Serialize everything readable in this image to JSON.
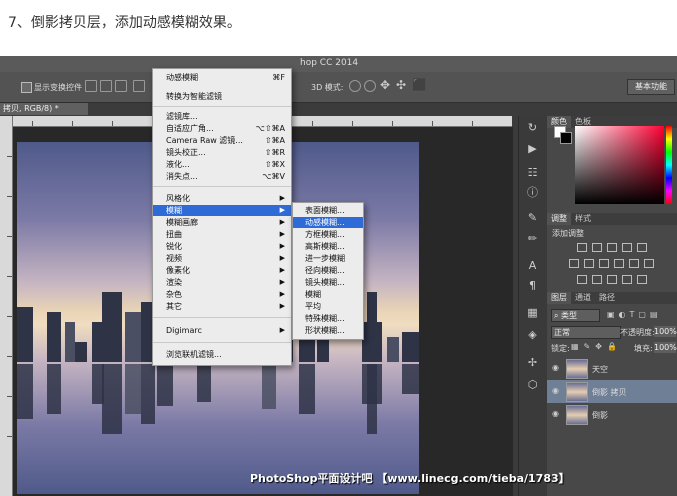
{
  "step_text": "7、倒影拷贝层，添加动感模糊效果。",
  "app_title_partial": "hop CC 2014",
  "workspace": "基本功能",
  "toolbar": {
    "show_transform": "显示变换控件",
    "mode3d": "3D 模式:"
  },
  "doc_tab": "拷贝, RGB/8) *",
  "filter_menu": {
    "items": [
      {
        "label": "动感模糊",
        "shortcut": "⌘F"
      },
      {
        "label": "转换为智能滤镜",
        "shortcut": ""
      },
      {
        "label": "滤镜库...",
        "shortcut": ""
      },
      {
        "label": "自适应广角...",
        "shortcut": "⌥⇧⌘A"
      },
      {
        "label": "Camera Raw 滤镜...",
        "shortcut": "⇧⌘A"
      },
      {
        "label": "镜头校正...",
        "shortcut": "⇧⌘R"
      },
      {
        "label": "液化...",
        "shortcut": "⇧⌘X"
      },
      {
        "label": "消失点...",
        "shortcut": "⌥⌘V"
      },
      {
        "label": "风格化",
        "shortcut": ""
      },
      {
        "label": "模糊",
        "shortcut": ""
      },
      {
        "label": "模糊画廊",
        "shortcut": ""
      },
      {
        "label": "扭曲",
        "shortcut": ""
      },
      {
        "label": "锐化",
        "shortcut": ""
      },
      {
        "label": "视频",
        "shortcut": ""
      },
      {
        "label": "像素化",
        "shortcut": ""
      },
      {
        "label": "渲染",
        "shortcut": ""
      },
      {
        "label": "杂色",
        "shortcut": ""
      },
      {
        "label": "其它",
        "shortcut": ""
      },
      {
        "label": "Digimarc",
        "shortcut": ""
      },
      {
        "label": "浏览联机滤镜...",
        "shortcut": ""
      }
    ]
  },
  "blur_submenu": {
    "items": [
      "表面模糊...",
      "动感模糊...",
      "方框模糊...",
      "高斯模糊...",
      "进一步模糊",
      "径向模糊...",
      "镜头模糊...",
      "模糊",
      "平均",
      "特殊模糊...",
      "形状模糊..."
    ]
  },
  "color_panel": {
    "tabs": [
      "颜色",
      "色板"
    ]
  },
  "adjust_panel": {
    "tabs": [
      "调整",
      "样式"
    ],
    "title": "添加调整"
  },
  "layers_panel": {
    "tabs": [
      "图层",
      "通道",
      "路径"
    ],
    "filter_kind": "类型",
    "blend_mode": "正常",
    "opacity_label": "不透明度:",
    "opacity_value": "100%",
    "lock_label": "锁定:",
    "fill_label": "填充:",
    "fill_value": "100%",
    "layers": [
      {
        "name": "天空",
        "selected": false
      },
      {
        "name": "倒影 拷贝",
        "selected": true
      },
      {
        "name": "倒影",
        "selected": false
      }
    ]
  },
  "watermark": "PhotoShop平面设计吧 【www.linecg.com/tieba/1783】"
}
